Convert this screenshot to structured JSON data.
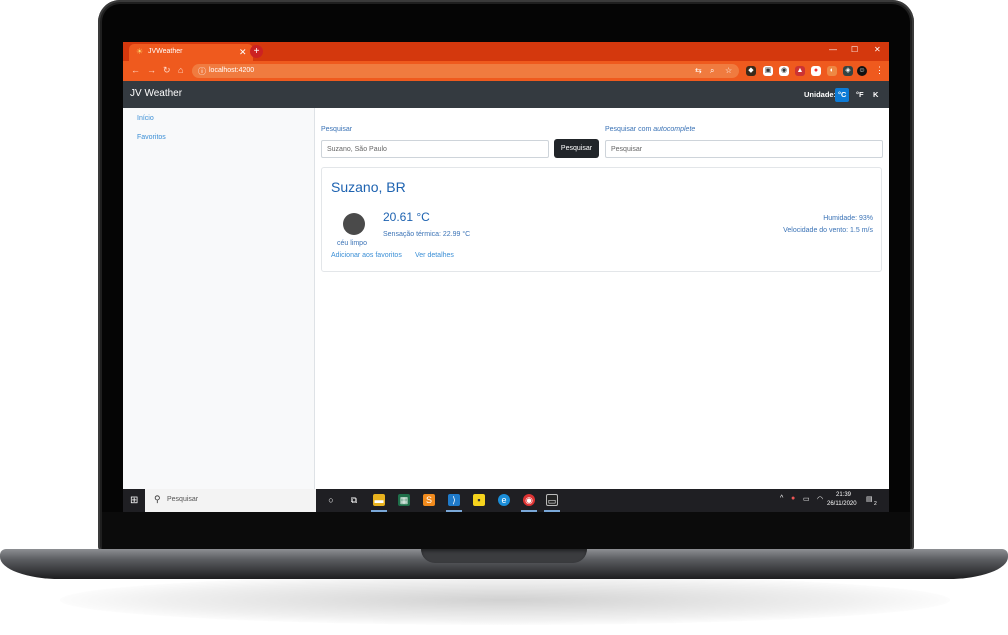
{
  "browser": {
    "tab_title": "JVWeather",
    "url": "localhost:4200"
  },
  "app": {
    "brand": "JV Weather",
    "unit_label": "Unidade:",
    "units": [
      "°C",
      "°F",
      "K"
    ],
    "active_unit": "°C"
  },
  "sidebar": {
    "items": [
      {
        "label": "Início"
      },
      {
        "label": "Favoritos"
      }
    ]
  },
  "search": {
    "label": "Pesquisar",
    "value": "Suzano, São Paulo",
    "button": "Pesquisar",
    "autocomplete_label_prefix": "Pesquisar com",
    "autocomplete_label_italic": "autocomplete",
    "autocomplete_placeholder": "Pesquisar"
  },
  "weather": {
    "city": "Suzano, BR",
    "temperature": "20.61 °C",
    "feels_like": "Sensação térmica: 22.99 °C",
    "description": "céu limpo",
    "humidity": "Humidade: 93%",
    "wind": "Velocidade do vento: 1.5 m/s",
    "add_favorite": "Adicionar aos favoritos",
    "details": "Ver detalhes"
  },
  "taskbar": {
    "search_placeholder": "Pesquisar",
    "time": "21:39",
    "date": "26/11/2020",
    "notification_count": "2"
  },
  "colors": {
    "browser_tabbar": "#d4380d",
    "browser_toolbar": "#ef5a1e",
    "app_navbar": "#343a40",
    "active_unit": "#0d7bd6",
    "link": "#3b8fd6",
    "city": "#1d62b0"
  }
}
